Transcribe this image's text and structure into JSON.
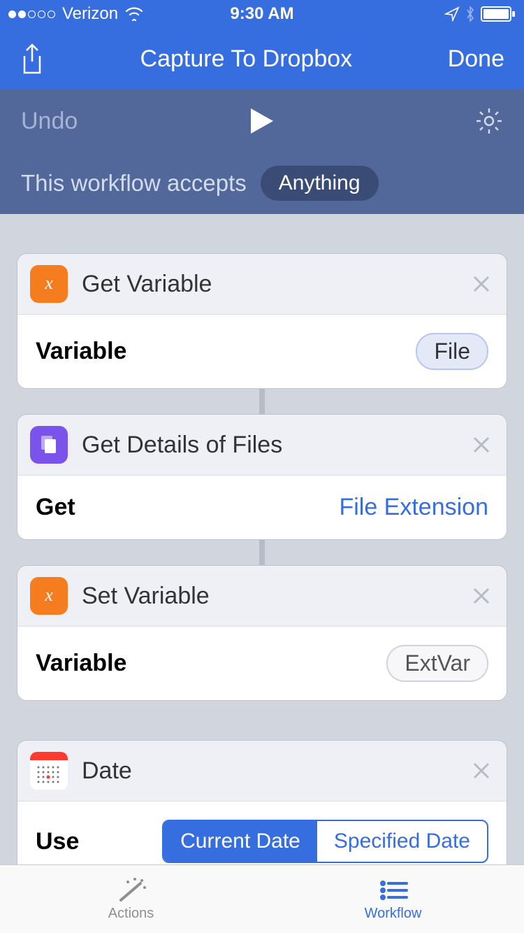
{
  "status_bar": {
    "carrier": "Verizon",
    "time": "9:30 AM"
  },
  "nav": {
    "title": "Capture To Dropbox",
    "done": "Done"
  },
  "toolbar": {
    "undo": "Undo"
  },
  "accepts": {
    "label": "This workflow accepts",
    "value": "Anything"
  },
  "actions": [
    {
      "icon": "variable",
      "title": "Get Variable",
      "param_label": "Variable",
      "param_value": "File",
      "param_style": "token-blue"
    },
    {
      "icon": "files",
      "title": "Get Details of Files",
      "param_label": "Get",
      "param_value": "File Extension",
      "param_style": "blue-text"
    },
    {
      "icon": "variable",
      "title": "Set Variable",
      "param_label": "Variable",
      "param_value": "ExtVar",
      "param_style": "token-gray"
    },
    {
      "icon": "calendar",
      "title": "Date",
      "param_label": "Use",
      "param_style": "segmented",
      "seg_options": [
        "Current Date",
        "Specified Date"
      ],
      "seg_active": 0
    }
  ],
  "tabs": {
    "actions": "Actions",
    "workflow": "Workflow"
  }
}
